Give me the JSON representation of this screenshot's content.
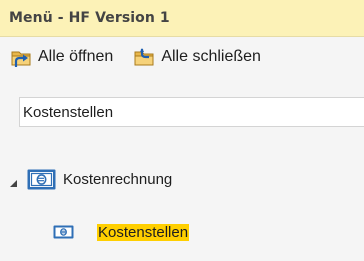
{
  "window": {
    "title": "Menü - HF Version 1",
    "title_bg": "#fcf2b7"
  },
  "toolbar": {
    "open_all_label": "Alle öffnen",
    "close_all_label": "Alle schließen",
    "open_all_icon": "expand-folder-icon",
    "close_all_icon": "collapse-folder-icon"
  },
  "search": {
    "value": "Kostenstellen"
  },
  "tree": {
    "root": {
      "label": "Kostenrechnung",
      "icon": "money-bill-icon",
      "expanded": true
    },
    "children": [
      {
        "label": "Kostenstellen",
        "icon": "money-bill-icon",
        "highlighted": true,
        "highlight_color": "#ffcf00"
      }
    ]
  }
}
